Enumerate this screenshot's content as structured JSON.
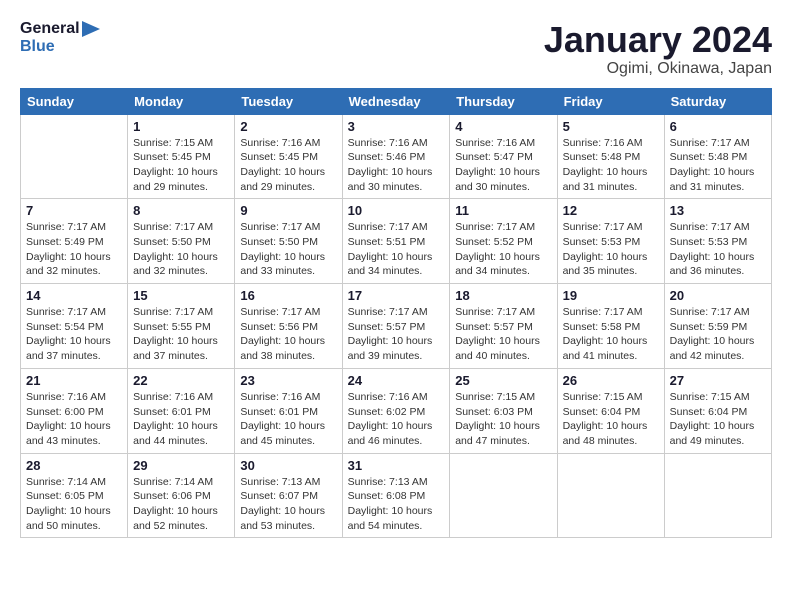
{
  "header": {
    "logo_line1": "General",
    "logo_line2": "Blue",
    "title": "January 2024",
    "subtitle": "Ogimi, Okinawa, Japan"
  },
  "calendar": {
    "days_of_week": [
      "Sunday",
      "Monday",
      "Tuesday",
      "Wednesday",
      "Thursday",
      "Friday",
      "Saturday"
    ],
    "weeks": [
      [
        {
          "day": "",
          "detail": ""
        },
        {
          "day": "1",
          "detail": "Sunrise: 7:15 AM\nSunset: 5:45 PM\nDaylight: 10 hours\nand 29 minutes."
        },
        {
          "day": "2",
          "detail": "Sunrise: 7:16 AM\nSunset: 5:45 PM\nDaylight: 10 hours\nand 29 minutes."
        },
        {
          "day": "3",
          "detail": "Sunrise: 7:16 AM\nSunset: 5:46 PM\nDaylight: 10 hours\nand 30 minutes."
        },
        {
          "day": "4",
          "detail": "Sunrise: 7:16 AM\nSunset: 5:47 PM\nDaylight: 10 hours\nand 30 minutes."
        },
        {
          "day": "5",
          "detail": "Sunrise: 7:16 AM\nSunset: 5:48 PM\nDaylight: 10 hours\nand 31 minutes."
        },
        {
          "day": "6",
          "detail": "Sunrise: 7:17 AM\nSunset: 5:48 PM\nDaylight: 10 hours\nand 31 minutes."
        }
      ],
      [
        {
          "day": "7",
          "detail": "Sunrise: 7:17 AM\nSunset: 5:49 PM\nDaylight: 10 hours\nand 32 minutes."
        },
        {
          "day": "8",
          "detail": "Sunrise: 7:17 AM\nSunset: 5:50 PM\nDaylight: 10 hours\nand 32 minutes."
        },
        {
          "day": "9",
          "detail": "Sunrise: 7:17 AM\nSunset: 5:50 PM\nDaylight: 10 hours\nand 33 minutes."
        },
        {
          "day": "10",
          "detail": "Sunrise: 7:17 AM\nSunset: 5:51 PM\nDaylight: 10 hours\nand 34 minutes."
        },
        {
          "day": "11",
          "detail": "Sunrise: 7:17 AM\nSunset: 5:52 PM\nDaylight: 10 hours\nand 34 minutes."
        },
        {
          "day": "12",
          "detail": "Sunrise: 7:17 AM\nSunset: 5:53 PM\nDaylight: 10 hours\nand 35 minutes."
        },
        {
          "day": "13",
          "detail": "Sunrise: 7:17 AM\nSunset: 5:53 PM\nDaylight: 10 hours\nand 36 minutes."
        }
      ],
      [
        {
          "day": "14",
          "detail": "Sunrise: 7:17 AM\nSunset: 5:54 PM\nDaylight: 10 hours\nand 37 minutes."
        },
        {
          "day": "15",
          "detail": "Sunrise: 7:17 AM\nSunset: 5:55 PM\nDaylight: 10 hours\nand 37 minutes."
        },
        {
          "day": "16",
          "detail": "Sunrise: 7:17 AM\nSunset: 5:56 PM\nDaylight: 10 hours\nand 38 minutes."
        },
        {
          "day": "17",
          "detail": "Sunrise: 7:17 AM\nSunset: 5:57 PM\nDaylight: 10 hours\nand 39 minutes."
        },
        {
          "day": "18",
          "detail": "Sunrise: 7:17 AM\nSunset: 5:57 PM\nDaylight: 10 hours\nand 40 minutes."
        },
        {
          "day": "19",
          "detail": "Sunrise: 7:17 AM\nSunset: 5:58 PM\nDaylight: 10 hours\nand 41 minutes."
        },
        {
          "day": "20",
          "detail": "Sunrise: 7:17 AM\nSunset: 5:59 PM\nDaylight: 10 hours\nand 42 minutes."
        }
      ],
      [
        {
          "day": "21",
          "detail": "Sunrise: 7:16 AM\nSunset: 6:00 PM\nDaylight: 10 hours\nand 43 minutes."
        },
        {
          "day": "22",
          "detail": "Sunrise: 7:16 AM\nSunset: 6:01 PM\nDaylight: 10 hours\nand 44 minutes."
        },
        {
          "day": "23",
          "detail": "Sunrise: 7:16 AM\nSunset: 6:01 PM\nDaylight: 10 hours\nand 45 minutes."
        },
        {
          "day": "24",
          "detail": "Sunrise: 7:16 AM\nSunset: 6:02 PM\nDaylight: 10 hours\nand 46 minutes."
        },
        {
          "day": "25",
          "detail": "Sunrise: 7:15 AM\nSunset: 6:03 PM\nDaylight: 10 hours\nand 47 minutes."
        },
        {
          "day": "26",
          "detail": "Sunrise: 7:15 AM\nSunset: 6:04 PM\nDaylight: 10 hours\nand 48 minutes."
        },
        {
          "day": "27",
          "detail": "Sunrise: 7:15 AM\nSunset: 6:04 PM\nDaylight: 10 hours\nand 49 minutes."
        }
      ],
      [
        {
          "day": "28",
          "detail": "Sunrise: 7:14 AM\nSunset: 6:05 PM\nDaylight: 10 hours\nand 50 minutes."
        },
        {
          "day": "29",
          "detail": "Sunrise: 7:14 AM\nSunset: 6:06 PM\nDaylight: 10 hours\nand 52 minutes."
        },
        {
          "day": "30",
          "detail": "Sunrise: 7:13 AM\nSunset: 6:07 PM\nDaylight: 10 hours\nand 53 minutes."
        },
        {
          "day": "31",
          "detail": "Sunrise: 7:13 AM\nSunset: 6:08 PM\nDaylight: 10 hours\nand 54 minutes."
        },
        {
          "day": "",
          "detail": ""
        },
        {
          "day": "",
          "detail": ""
        },
        {
          "day": "",
          "detail": ""
        }
      ]
    ]
  }
}
